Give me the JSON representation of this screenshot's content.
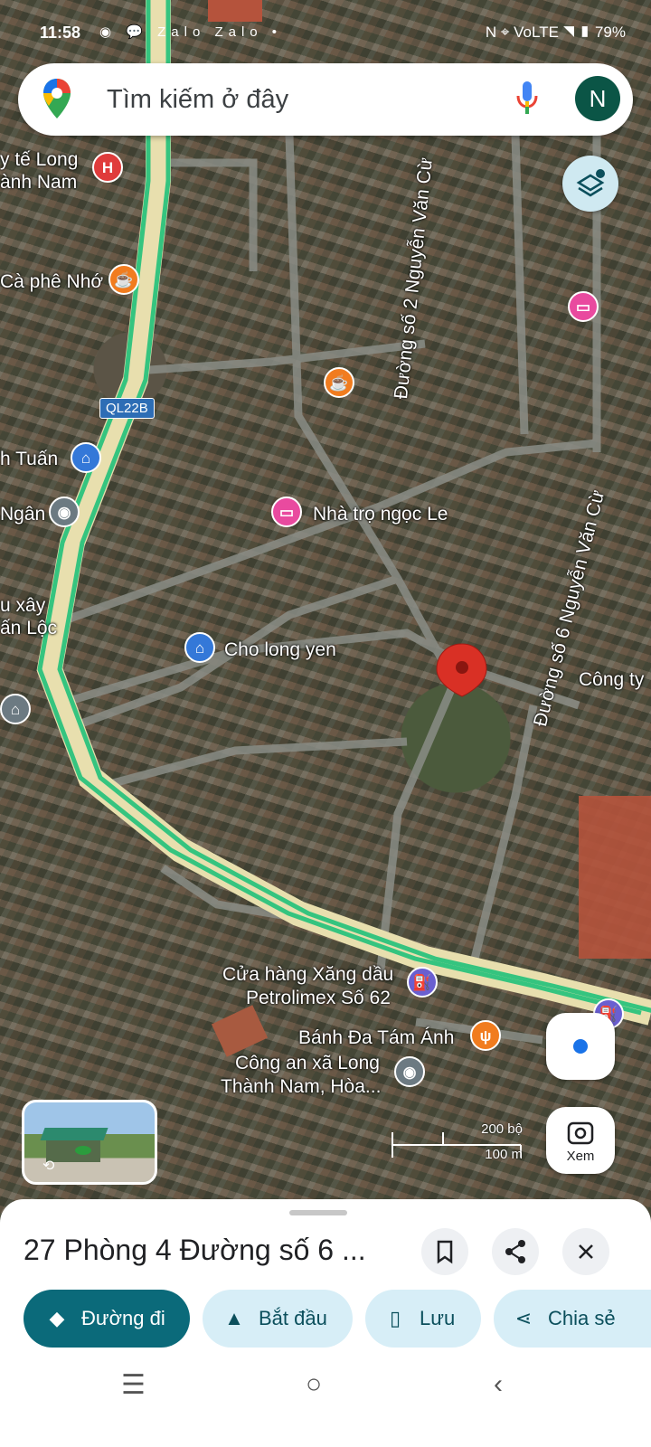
{
  "status_bar": {
    "time": "11:58",
    "notif_icons": "◉ 💬 Zalo Zalo •",
    "right": "N ⌖ VoLTE ◥ ▮ 79%"
  },
  "search": {
    "placeholder": "Tìm kiếm ở đây",
    "avatar_letter": "N"
  },
  "map": {
    "labels": [
      "y tế Long",
      "ành Nam",
      "Cà phê Nhớ",
      "Đường số 2 Nguyễn Văn Cừ",
      "h Tuấn",
      "Ngân",
      "Nhà trọ ngọc Le",
      "u xây",
      "ấn Lộc",
      "Cho long yen",
      "Đường số 6 Nguyễn Văn Cừ",
      "Công ty",
      "Cửa hàng Xăng dầu",
      "Petrolimex Số 62",
      "Bánh Đa Tám Ánh",
      "Công an xã Long",
      "Thành Nam, Hòa..."
    ],
    "road_shield": "QL22B",
    "scale": {
      "top": "200 bộ",
      "bottom": "100 m"
    }
  },
  "controls": {
    "lens_label": "Xem"
  },
  "place": {
    "title": "27 Phòng 4 Đường số 6 ...",
    "actions": [
      {
        "label": "Đường đi",
        "icon": "directions-icon"
      },
      {
        "label": "Bắt đầu",
        "icon": "navigation-arrow-icon"
      },
      {
        "label": "Lưu",
        "icon": "bookmark-icon"
      },
      {
        "label": "Chia sẻ",
        "icon": "share-icon"
      }
    ]
  },
  "colors": {
    "accent": "#0b6a7a",
    "chip_bg": "#d7eef7",
    "pin": "#d93025"
  }
}
